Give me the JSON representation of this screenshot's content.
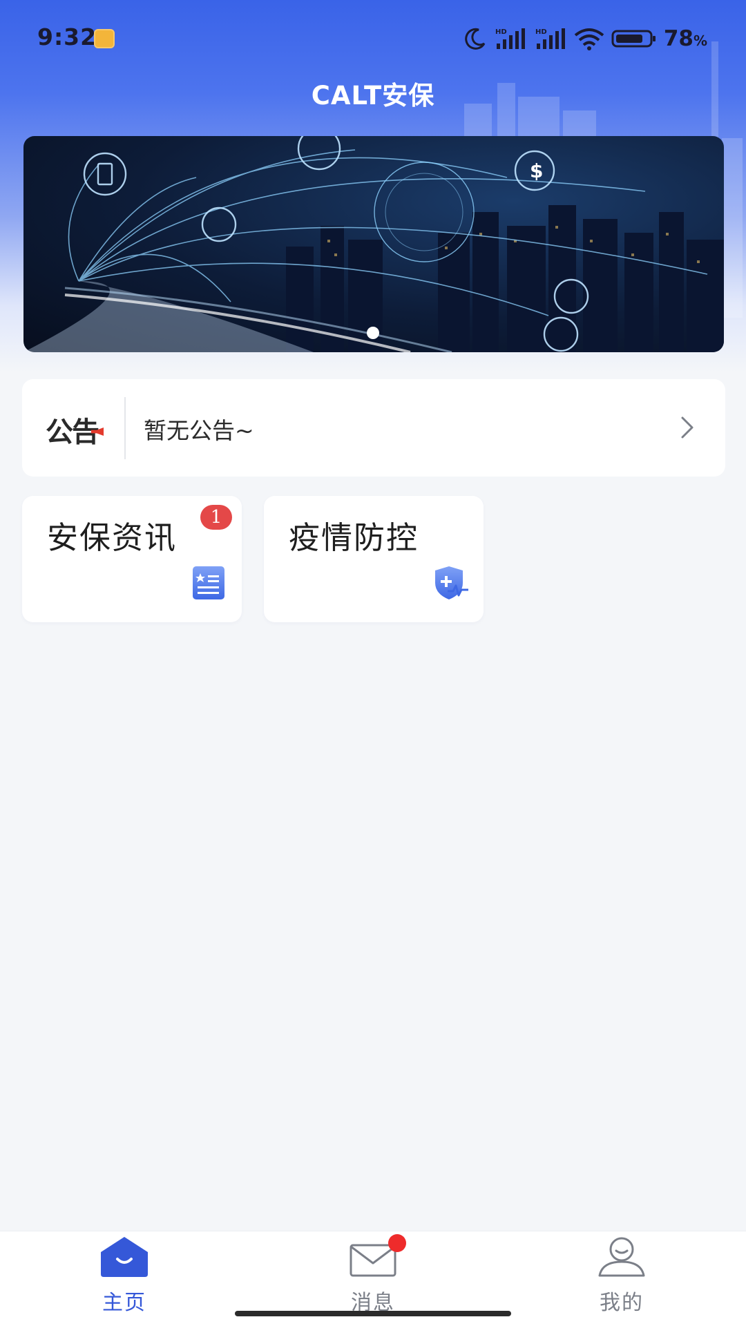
{
  "status_bar": {
    "time": "9:32",
    "battery_percent": "78",
    "battery_unit": "%",
    "icons": [
      "notification-app-icon",
      "moon-icon",
      "signal-hd-icon",
      "signal-hd-icon",
      "wifi-icon",
      "battery-icon"
    ]
  },
  "header": {
    "title": "CALT安保"
  },
  "banner": {
    "image": "smart-city-network-banner",
    "page_count": 1,
    "active_page": 1
  },
  "notice": {
    "logo_text": "公告",
    "text": "暂无公告~",
    "icon": "chevron-right-icon"
  },
  "cards": [
    {
      "title": "安保资讯",
      "badge": "1",
      "icon": "news-list-icon"
    },
    {
      "title": "疫情防控",
      "icon": "medical-shield-icon"
    }
  ],
  "bottom_nav": {
    "items": [
      {
        "label": "主页",
        "icon": "home-icon",
        "active": true
      },
      {
        "label": "消息",
        "icon": "mail-icon",
        "active": false,
        "has_dot": true
      },
      {
        "label": "我的",
        "icon": "user-icon",
        "active": false
      }
    ]
  },
  "colors": {
    "brand_blue": "#3a63e8",
    "active_nav": "#3558d8",
    "badge_red": "#e44848",
    "background": "#f4f6f9"
  }
}
